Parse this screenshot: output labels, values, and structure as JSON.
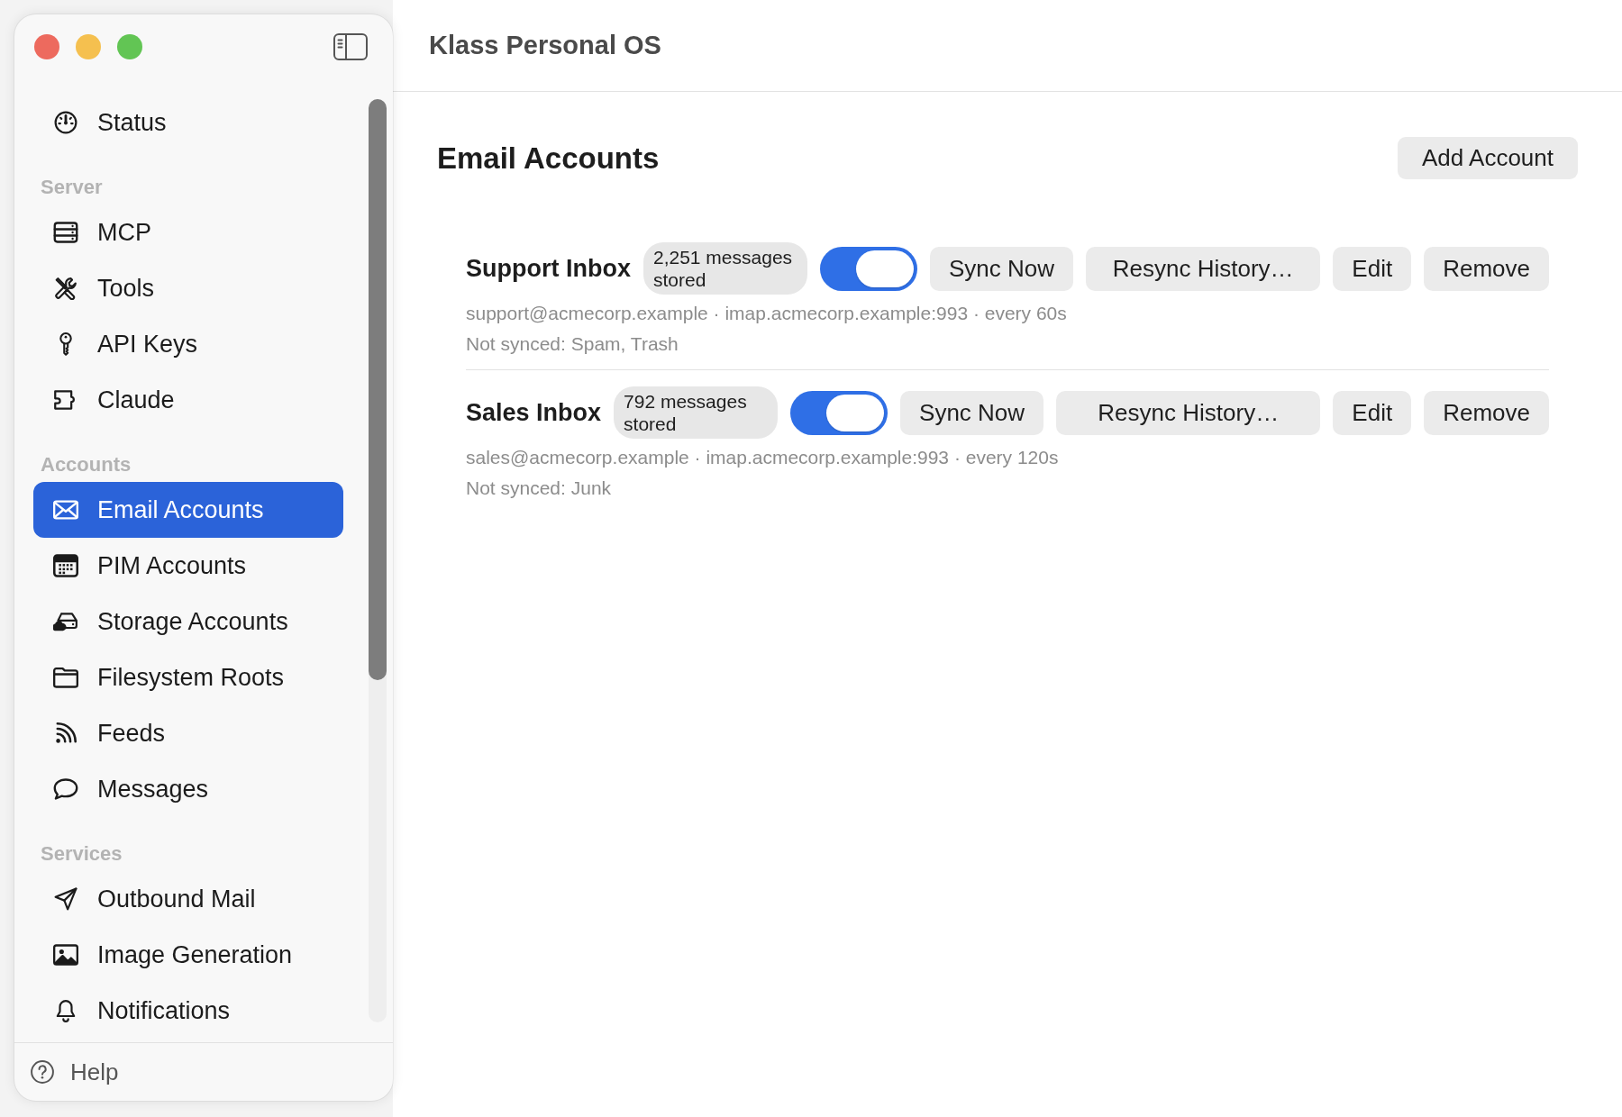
{
  "window": {
    "title": "Klass Personal OS"
  },
  "sidebar": {
    "sections": [
      {
        "items": [
          {
            "label": "Status",
            "selected": false
          }
        ]
      },
      {
        "header": "Server",
        "items": [
          {
            "label": "MCP",
            "selected": false
          },
          {
            "label": "Tools",
            "selected": false
          },
          {
            "label": "API Keys",
            "selected": false
          },
          {
            "label": "Claude",
            "selected": false
          }
        ]
      },
      {
        "header": "Accounts",
        "items": [
          {
            "label": "Email Accounts",
            "selected": true
          },
          {
            "label": "PIM Accounts",
            "selected": false
          },
          {
            "label": "Storage Accounts",
            "selected": false
          },
          {
            "label": "Filesystem Roots",
            "selected": false
          },
          {
            "label": "Feeds",
            "selected": false
          },
          {
            "label": "Messages",
            "selected": false
          }
        ]
      },
      {
        "header": "Services",
        "items": [
          {
            "label": "Outbound Mail",
            "selected": false
          },
          {
            "label": "Image Generation",
            "selected": false
          },
          {
            "label": "Notifications",
            "selected": false
          }
        ]
      }
    ],
    "footer": {
      "label": "Help"
    }
  },
  "page": {
    "title": "Email Accounts",
    "add_button": "Add Account"
  },
  "accounts": [
    {
      "name": "Support Inbox",
      "badge": "2,251 messages stored",
      "enabled": true,
      "buttons": [
        "Sync Now",
        "Resync History…",
        "Edit",
        "Remove"
      ],
      "details": "support@acmecorp.example · imap.acmecorp.example:993 · every 60s",
      "not_synced": "Not synced: Spam, Trash"
    },
    {
      "name": "Sales Inbox",
      "badge": "792 messages stored",
      "enabled": true,
      "buttons": [
        "Sync Now",
        "Resync History…",
        "Edit",
        "Remove"
      ],
      "details": "sales@acmecorp.example · imap.acmecorp.example:993 · every 120s",
      "not_synced": "Not synced: Junk"
    }
  ]
}
